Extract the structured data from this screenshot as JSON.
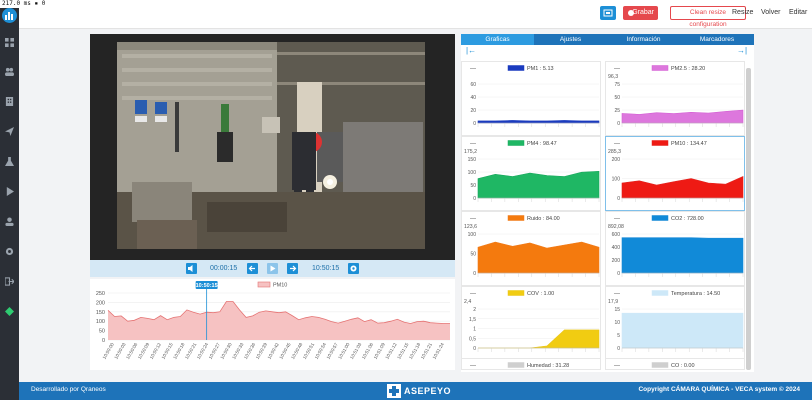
{
  "perf": "217.0",
  "topbar": {
    "record_label": "Grabar",
    "clean_resize_label": "Clean resize configuration",
    "resize_label": "Resize",
    "back_label": "Volver",
    "edit_label": "Editar"
  },
  "player": {
    "current_time": "00:00:15",
    "clock_time": "10:50:15"
  },
  "pm_chart": {
    "legend": "PM10",
    "marker_time": "10:50:15"
  },
  "tabs": [
    "Graficas",
    "Ajustes",
    "Información",
    "Marcadores"
  ],
  "nav": {
    "prev": "|←",
    "next": "→|"
  },
  "sensors": [
    {
      "name": "PM1",
      "value": "5.13",
      "color": "#1a3bbf",
      "fill": "#1a3bbf",
      "ymax": "",
      "ticks": [
        "60",
        "40",
        "20",
        "0"
      ]
    },
    {
      "name": "PM2.5",
      "value": "28.20",
      "color": "#d45fd4",
      "fill": "#dd77dd",
      "ymax": "96,3",
      "ticks": [
        "75",
        "50",
        "25",
        "0"
      ]
    },
    {
      "name": "PM4",
      "value": "98.47",
      "color": "#17a85c",
      "fill": "#1fb764",
      "ymax": "175,2",
      "ticks": [
        "150",
        "100",
        "50",
        "0"
      ]
    },
    {
      "name": "PM10",
      "value": "134.47",
      "color": "#e3211c",
      "fill": "#ee1a14",
      "ymax": "285,3",
      "ticks": [
        "200",
        "100",
        "0"
      ]
    },
    {
      "name": "Ruido",
      "value": "84.00",
      "color": "#f07a1a",
      "fill": "#f47a0e",
      "ymax": "123,6",
      "ticks": [
        "100",
        "50",
        "0"
      ]
    },
    {
      "name": "CO2",
      "value": "728.00",
      "color": "#1789d6",
      "fill": "#118ad8",
      "ymax": "892,08",
      "ticks": [
        "600",
        "400",
        "200",
        "0"
      ]
    },
    {
      "name": "COV",
      "value": "1.00",
      "color": "#e9c51a",
      "fill": "#f1cc12",
      "ymax": "2,4",
      "ticks": [
        "2",
        "1,5",
        "1",
        "0,5",
        "0"
      ]
    },
    {
      "name": "Temperatura",
      "value": "14.50",
      "color": "#cfe9f8",
      "fill": "#cde8f8",
      "ymax": "17,9",
      "ticks": [
        "15",
        "10",
        "5",
        "0"
      ]
    },
    {
      "name": "Humedad",
      "value": "31.28",
      "color": "#cfcfcf",
      "fill": "#cfcfcf",
      "ymax": "",
      "ticks": []
    },
    {
      "name": "CO",
      "value": "0.00",
      "color": "#cfcfcf",
      "fill": "#cfcfcf",
      "ymax": "",
      "ticks": []
    }
  ],
  "footer": {
    "left": "Desarrollado por Qraneos",
    "brand": "ASEPEYO",
    "right": "Copyright CÁMARA QUÍMICA - VECA system © 2024"
  },
  "chart_data": {
    "type": "area",
    "series": [
      {
        "name": "PM10",
        "values": [
          158,
          125,
          128,
          100,
          105,
          120,
          115,
          108,
          130,
          108,
          120,
          125,
          160,
          148,
          138,
          148,
          145,
          150,
          205,
          205,
          160,
          120,
          128,
          148,
          155,
          150,
          145,
          150,
          130,
          108,
          118,
          125,
          120,
          110,
          98,
          90,
          100,
          110,
          118,
          98,
          108,
          90,
          92,
          100,
          110,
          95,
          88,
          98,
          100,
          92,
          90,
          88,
          88
        ]
      }
    ],
    "x": [
      "10:50:00",
      "10:50:03",
      "10:50:06",
      "10:50:09",
      "10:50:12",
      "10:50:15",
      "10:50:18",
      "10:50:21",
      "10:50:24",
      "10:50:27",
      "10:50:30",
      "10:50:33",
      "10:50:36",
      "10:50:39",
      "10:50:42",
      "10:50:45",
      "10:50:48",
      "10:50:51",
      "10:50:54",
      "10:50:57",
      "10:51:00",
      "10:51:03",
      "10:51:06",
      "10:51:09",
      "10:51:12",
      "10:51:15",
      "10:51:18",
      "10:51:21",
      "10:51:24"
    ],
    "yticks": [
      "250",
      "200",
      "150",
      "100",
      "50",
      "0"
    ],
    "ylim": [
      0,
      250
    ],
    "grid": true,
    "legend": "top-center"
  }
}
